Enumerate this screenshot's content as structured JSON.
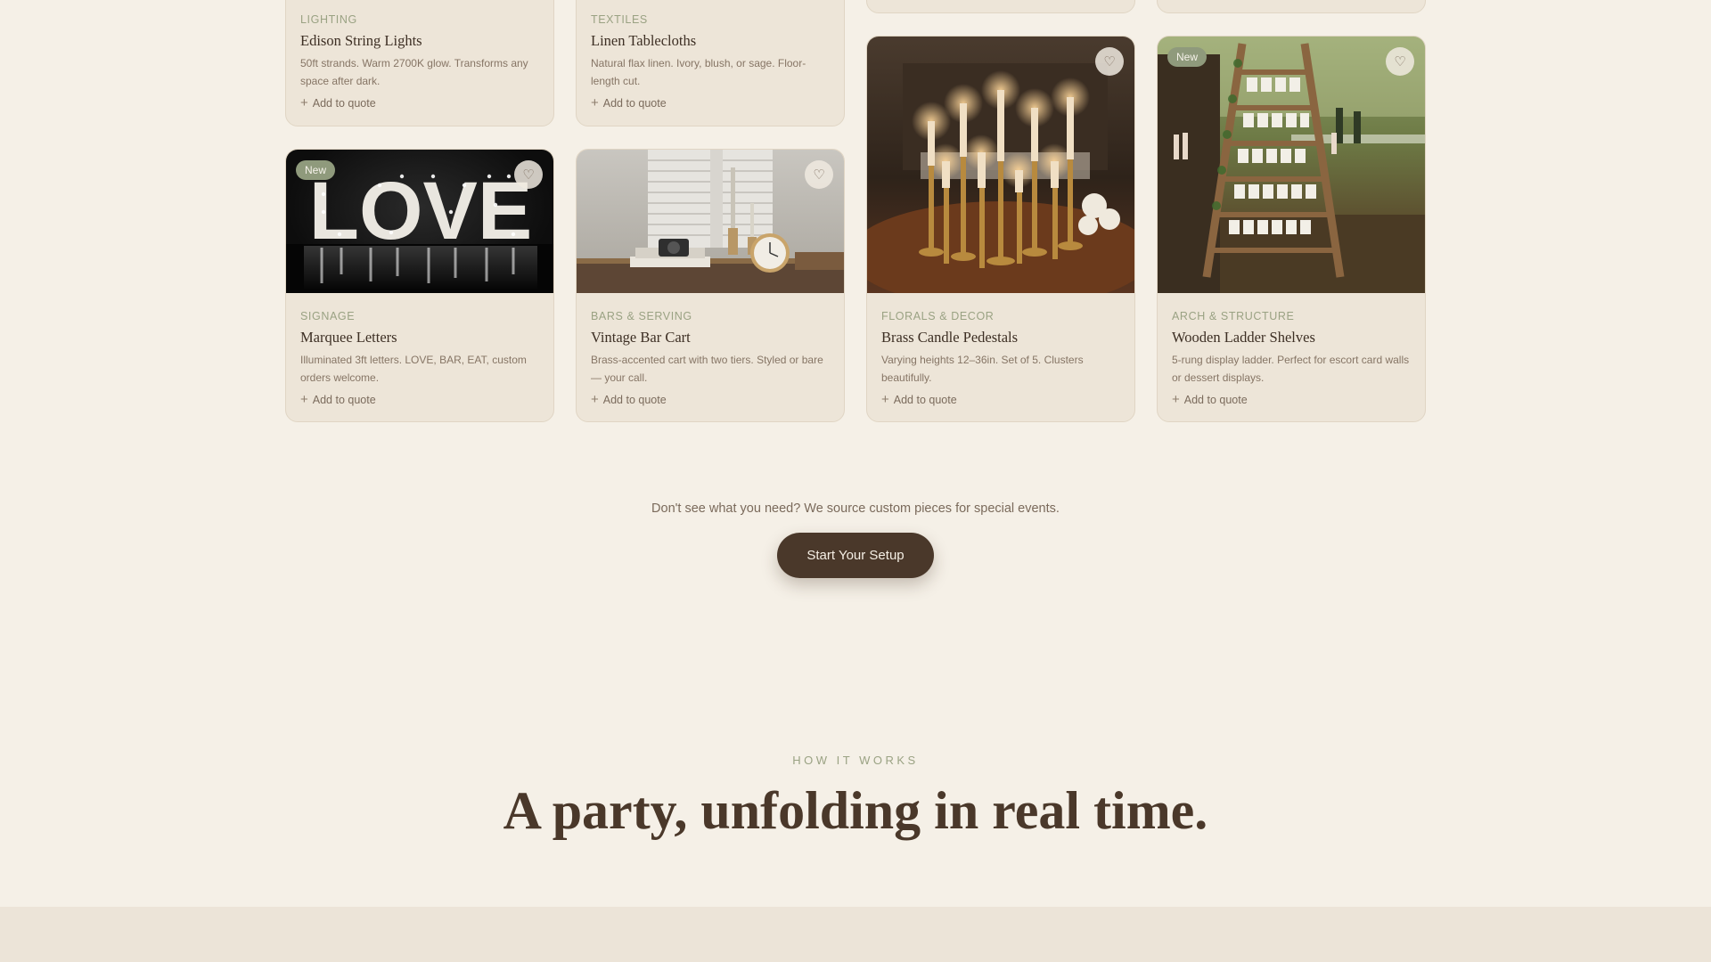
{
  "colors": {
    "page_bg": "#f5f0e7",
    "card_bg": "#ede5d8",
    "accent_sage": "#9aa283",
    "badge_new": "#8f9a7c",
    "button_dark": "#4a382a",
    "text_dark": "#3d2f24"
  },
  "common": {
    "add_label": "Add to quote",
    "new_label": "New",
    "plus_icon": "+",
    "heart_icon": "♡"
  },
  "products": [
    {
      "category": "LIGHTING",
      "title": "Edison String Lights",
      "description": "50ft strands. Warm 2700K glow. Transforms any space after dark.",
      "is_new": false
    },
    {
      "category": "TEXTILES",
      "title": "Linen Tablecloths",
      "description": "Natural flax linen. Ivory, blush, or sage. Floor-length cut.",
      "is_new": false
    },
    {
      "category": "SIGNAGE",
      "title": "Marquee Letters",
      "description": "Illuminated 3ft letters. LOVE, BAR, EAT, custom orders welcome.",
      "image_text": "LOVE",
      "is_new": true
    },
    {
      "category": "BARS & SERVING",
      "title": "Vintage Bar Cart",
      "description": "Brass-accented cart with two tiers. Styled or bare — your call.",
      "is_new": false
    },
    {
      "category": "FLORALS & DECOR",
      "title": "Brass Candle Pedestals",
      "description": "Varying heights 12–36in. Set of 5. Clusters beautifully.",
      "is_new": false
    },
    {
      "category": "ARCH & STRUCTURE",
      "title": "Wooden Ladder Shelves",
      "description": "5-rung display ladder. Perfect for escort card walls or dessert displays.",
      "is_new": true
    }
  ],
  "cta": {
    "text": "Don't see what you need? We source custom pieces for special events.",
    "button_label": "Start Your Setup"
  },
  "how_it_works": {
    "eyebrow": "HOW IT WORKS",
    "headline": "A party, unfolding in real time."
  }
}
